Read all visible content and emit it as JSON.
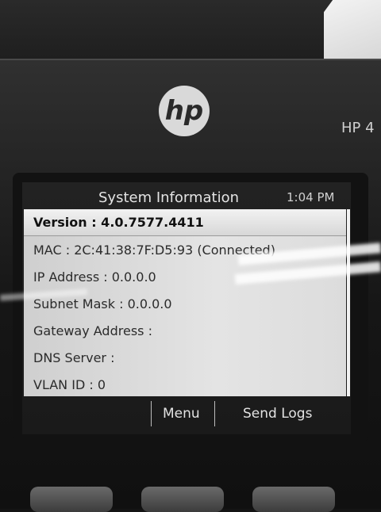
{
  "device": {
    "brand": "hp",
    "model": "HP 4"
  },
  "screen": {
    "title": "System Information",
    "time": "1:04 PM",
    "rows": [
      {
        "label": "Version : 4.0.7577.4411",
        "selected": true
      },
      {
        "label": "MAC : 2C:41:38:7F:D5:93 (Connected)"
      },
      {
        "label": "IP Address : 0.0.0.0"
      },
      {
        "label": "Subnet Mask : 0.0.0.0"
      },
      {
        "label": "Gateway Address :"
      },
      {
        "label": "DNS Server :"
      },
      {
        "label": "VLAN ID : 0"
      }
    ],
    "softkeys": {
      "key1": "",
      "key2": "Menu",
      "key3": "Send Logs"
    }
  }
}
